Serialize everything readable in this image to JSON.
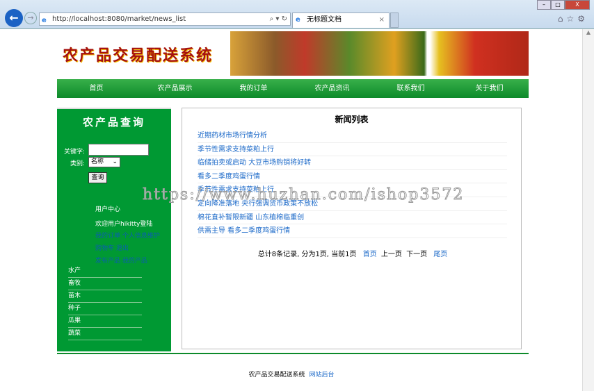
{
  "browser": {
    "url": "http://localhost:8080/market/news_list",
    "tab_title": "无标题文档"
  },
  "site": {
    "title": "农产品交易配送系统"
  },
  "nav": [
    "首页",
    "农产品展示",
    "我的订单",
    "农产品资讯",
    "联系我们",
    "关于我们"
  ],
  "sidebar": {
    "title": "农产品查询",
    "keyword_label": "关键字:",
    "category_label": "类别:",
    "category_value": "名称",
    "search_button": "查询",
    "user_center": "用户中心",
    "welcome": "欢迎用户hikitty登陆",
    "links": [
      [
        "我的订单",
        "个人信息维护"
      ],
      [
        "购物车",
        "退出"
      ],
      [
        "发布产品",
        "我的产品"
      ]
    ],
    "categories": [
      "水产",
      "畜牧",
      "苗木",
      "种子",
      "瓜果",
      "蔬菜"
    ]
  },
  "main": {
    "title": "新闻列表",
    "news": [
      "近期药材市场行情分析",
      "季节性需求支持菜粕上行",
      "临储拍卖或启动 大豆市场购销将好转",
      "看多二季度鸡蛋行情",
      "季节性需求支持菜粕上行",
      "定向降准落地 央行强调货币政策不放松",
      "棉花直补暂限新疆 山东植棉临重创",
      "供需主导 看多二季度鸡蛋行情"
    ],
    "pager": {
      "summary": "总计8条记录, 分为1页, 当前1页",
      "first": "首页",
      "prev": "上一页",
      "next": "下一页",
      "last": "尾页"
    }
  },
  "footer": {
    "text": "农产品交易配送系统",
    "admin_link": "网站后台"
  },
  "watermark": "https://www.huzhan.com/ishop3572"
}
